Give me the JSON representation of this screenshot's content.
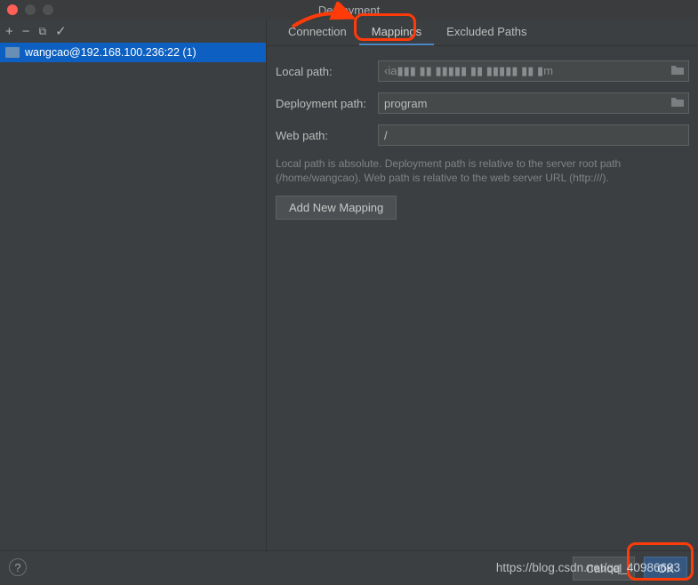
{
  "window": {
    "title": "Deployment"
  },
  "sidebar": {
    "toolbar": {
      "add": "+",
      "remove": "−",
      "copy": "⧉",
      "check": "✓"
    },
    "server": {
      "name": "wangcao@192.168.100.236:22 (1)"
    }
  },
  "tabs": {
    "connection": "Connection",
    "mappings": "Mappings",
    "excluded": "Excluded Paths"
  },
  "form": {
    "local_label": "Local path:",
    "local_value": "‹ia▮▮▮ ▮▮  ▮▮▮▮▮ ▮▮  ▮▮▮▮▮   ▮▮  ▮m",
    "deploy_label": "Deployment path:",
    "deploy_value": "program",
    "web_label": "Web path:",
    "web_value": "/",
    "help": "Local path is absolute. Deployment path is relative to the server root path (/home/wangcao). Web path is relative to the web server URL (http:///).",
    "add_mapping": "Add New Mapping"
  },
  "footer": {
    "cancel": "Cancel",
    "ok": "OK"
  },
  "watermark": {
    "text": "https://blog.csdn.net/qq_",
    "num": "40986693"
  }
}
